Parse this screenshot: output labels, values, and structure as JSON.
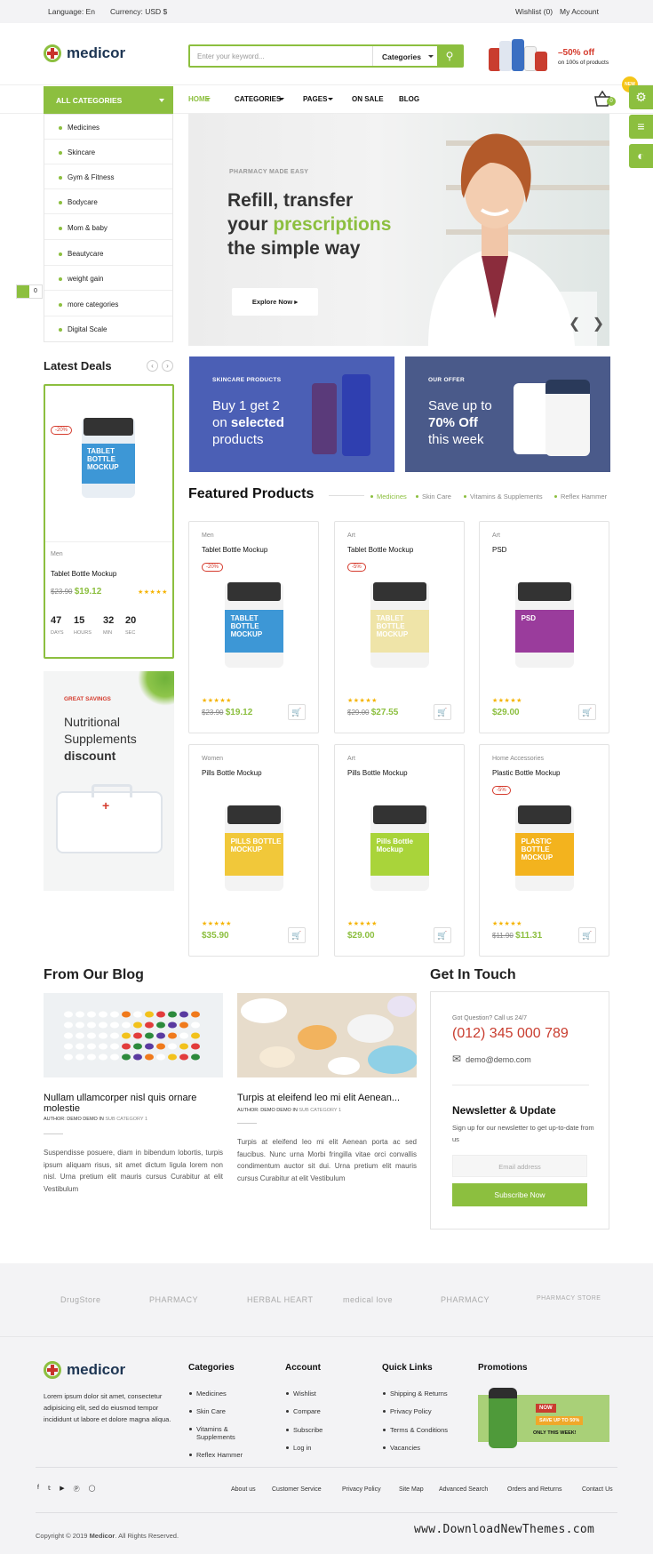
{
  "topbar": {
    "language": "Language: En",
    "currency": "Currency: USD $",
    "wishlist": "Wishlist (0)",
    "account": "My Account"
  },
  "header": {
    "logo": "medicor",
    "search_placeholder": "Enter your keyword...",
    "search_category": "Categories",
    "promo_title": "–50% off",
    "promo_sub": "on 100s of products"
  },
  "nav": {
    "all_categories": "ALL CATEGORIES",
    "items": [
      "HOME",
      "CATEGORIES",
      "PAGES",
      "ON SALE",
      "BLOG"
    ],
    "cart_count": "0"
  },
  "categories": [
    "Medicines",
    "Skincare",
    "Gym & Fitness",
    "Bodycare",
    "Mom & baby",
    "Beautycare",
    "weight gain",
    "more categories",
    "Digital Scale"
  ],
  "side_tools": {
    "new_badge": "NEW",
    "wishlist_count": "0"
  },
  "hero": {
    "subtitle": "PHARMACY MADE EASY",
    "line1": "Refill, transfer",
    "line2a": "your ",
    "line2b": "prescriptions",
    "line3": "the simple way",
    "button": "Explore Now"
  },
  "latest_deals": {
    "title": "Latest Deals",
    "badge": "-20%",
    "product_label": "TABLET BOTTLE MOCKUP",
    "category": "Men",
    "name": "Tablet Bottle Mockup",
    "old_price": "$23.90",
    "price": "$19.12",
    "countdown": [
      {
        "value": "47",
        "unit": "DAYS"
      },
      {
        "value": "15",
        "unit": "HOURS"
      },
      {
        "value": "32",
        "unit": "MIN"
      },
      {
        "value": "20",
        "unit": "SEC"
      }
    ]
  },
  "savings_banner": {
    "tag": "GREAT SAVINGS",
    "line1": "Nutritional",
    "line2": "Supplements",
    "line3": "discount"
  },
  "banners": [
    {
      "tag": "SKINCARE PRODUCTS",
      "l1": "Buy 1 get 2",
      "l2a": "on ",
      "l2b": "selected",
      "l3": "products",
      "color": "#4b5fb5"
    },
    {
      "tag": "OUR OFFER",
      "l1": "Save up to",
      "l2a": "",
      "l2b": "70% Off",
      "l3": "this week",
      "color": "#4a5a8a"
    }
  ],
  "featured": {
    "title": "Featured Products",
    "tabs": [
      "Medicines",
      "Skin Care",
      "Vitamins & Supplements",
      "Reflex Hammer"
    ],
    "products": [
      {
        "category": "Men",
        "name": "Tablet Bottle Mockup",
        "badge": "-20%",
        "old": "$23.90",
        "price": "$19.12",
        "label": "TABLET BOTTLE MOCKUP",
        "color": "#3d97d6"
      },
      {
        "category": "Art",
        "name": "Tablet Bottle Mockup",
        "badge": "-5%",
        "old": "$29.00",
        "price": "$27.55",
        "label": "TABLET BOTTLE MOCKUP",
        "color": "#efe4a8"
      },
      {
        "category": "Art",
        "name": "PSD",
        "badge": "",
        "old": "",
        "price": "$29.00",
        "label": "PSD",
        "color": "#9a3c9c"
      },
      {
        "category": "Women",
        "name": "Pills Bottle Mockup",
        "badge": "",
        "old": "",
        "price": "$35.90",
        "label": "PILLS BOTTLE MOCKUP",
        "color": "#f1c83a"
      },
      {
        "category": "Art",
        "name": "Pills Bottle Mockup",
        "badge": "",
        "old": "",
        "price": "$29.00",
        "label": "Pills Bottle Mockup",
        "color": "#a9d43a"
      },
      {
        "category": "Home Accessories",
        "name": "Plastic Bottle Mockup",
        "badge": "-5%",
        "old": "$11.90",
        "price": "$11.31",
        "label": "PLASTIC BOTTLE MOCKUP",
        "color": "#f3b31e"
      }
    ]
  },
  "blog": {
    "title": "From Our Blog",
    "posts": [
      {
        "title": "Nullam ullamcorper nisl quis ornare molestie",
        "author": "AUTHOR: DEMO DEMO IN ",
        "cat": "SUB CATEGORY 1",
        "text": "Suspendisse posuere, diam in bibendum lobortis, turpis ipsum aliquam risus, sit amet dictum ligula lorem non nisl. Urna pretium elit mauris cursus Curabitur at elit Vestibulum"
      },
      {
        "title": "Turpis at eleifend leo mi elit Aenean...",
        "author": "AUTHOR: DEMO DEMO IN ",
        "cat": "SUB CATEGORY 1",
        "text": "Turpis at eleifend leo mi elit Aenean porta ac sed faucibus. Nunc urna Morbi fringilla vitae orci convallis condimentum auctor sit dui. Urna pretium elit mauris cursus Curabitur at elit Vestibulum"
      }
    ]
  },
  "contact": {
    "title": "Get In Touch",
    "question": "Got Question? Call us 24/7",
    "phone": "(012) 345 000 789",
    "email": "demo@demo.com",
    "newsletter_title": "Newsletter & Update",
    "newsletter_text": "Sign up for our newsletter to get up-to-date from us",
    "email_placeholder": "Email address",
    "subscribe": "Subscribe Now"
  },
  "brands": [
    "DrugStore",
    "PHARMACY",
    "HERBAL HEART",
    "medical love",
    "PHARMACY",
    "PHARMACY STORE"
  ],
  "footer": {
    "logo": "medicor",
    "about": "Lorem ipsum dolor sit amet, consectetur adipisicing elit, sed do eiusmod tempor incididunt ut labore et dolore magna aliqua.",
    "columns": [
      {
        "title": "Categories",
        "links": [
          "Medicines",
          "Skin Care",
          "Vitamins & Supplements",
          "Reflex Hammer"
        ]
      },
      {
        "title": "Account",
        "links": [
          "Wishlist",
          "Compare",
          "Subscribe",
          "Log in"
        ]
      },
      {
        "title": "Quick Links",
        "links": [
          "Shipping & Returns",
          "Privacy Policy",
          "Terms & Conditions",
          "Vacancies"
        ]
      }
    ],
    "promotions_title": "Promotions",
    "promo_now": "NOW",
    "promo_save": "SAVE UP TO 50%",
    "promo_week": "ONLY THIS WEEK!",
    "bottom_links": [
      "About us",
      "Customer Service",
      "Privacy Policy",
      "Site Map",
      "Advanced Search",
      "Orders and Returns",
      "Contact Us"
    ],
    "copyright_pre": "Copyright © 2019 ",
    "copyright_brand": "Medicor",
    "copyright_post": ". All Rights Reserved.",
    "watermark": "www.DownloadNewThemes.com"
  }
}
